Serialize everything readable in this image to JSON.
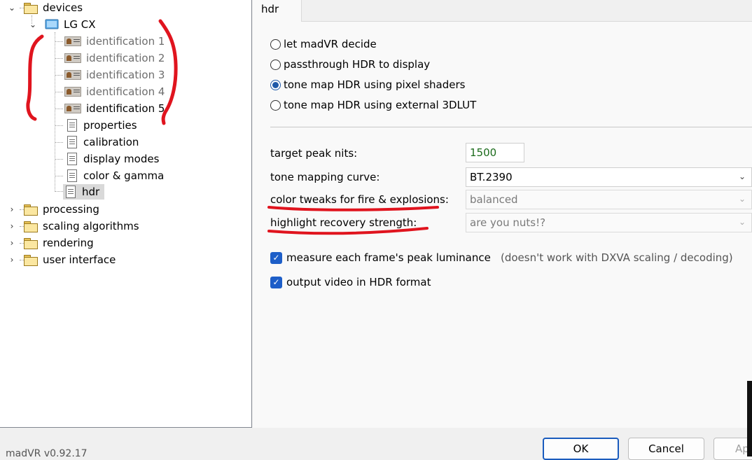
{
  "tree": {
    "devices": "devices",
    "device_name": "LG CX",
    "identifications": [
      "identification 1",
      "identification 2",
      "identification 3",
      "identification 4",
      "identification 5"
    ],
    "settings": [
      "properties",
      "calibration",
      "display modes",
      "color & gamma",
      "hdr"
    ],
    "groups": [
      "processing",
      "scaling algorithms",
      "rendering",
      "user interface"
    ]
  },
  "tab": {
    "label": "hdr"
  },
  "hdr_mode": {
    "options": [
      "let madVR decide",
      "passthrough HDR to display",
      "tone map HDR using pixel shaders",
      "tone map HDR using external 3DLUT"
    ],
    "selected_index": 2
  },
  "settings": {
    "target_peak_label": "target peak nits:",
    "target_peak_value": "1500",
    "curve_label": "tone mapping curve:",
    "curve_value": "BT.2390",
    "fire_label": "color tweaks for fire & explosions:",
    "fire_value": "balanced",
    "highlight_label": "highlight recovery strength:",
    "highlight_value": "are you nuts!?"
  },
  "checks": {
    "measure_label": "measure each frame's peak luminance",
    "measure_note": "(doesn't work with DXVA scaling / decoding)",
    "output_label": "output video in HDR format"
  },
  "footer": {
    "version": "madVR v0.92.17",
    "ok": "OK",
    "cancel": "Cancel",
    "apply": "Ap"
  },
  "colors": {
    "accent": "#1a5bbd",
    "annotation": "#e0141e"
  }
}
